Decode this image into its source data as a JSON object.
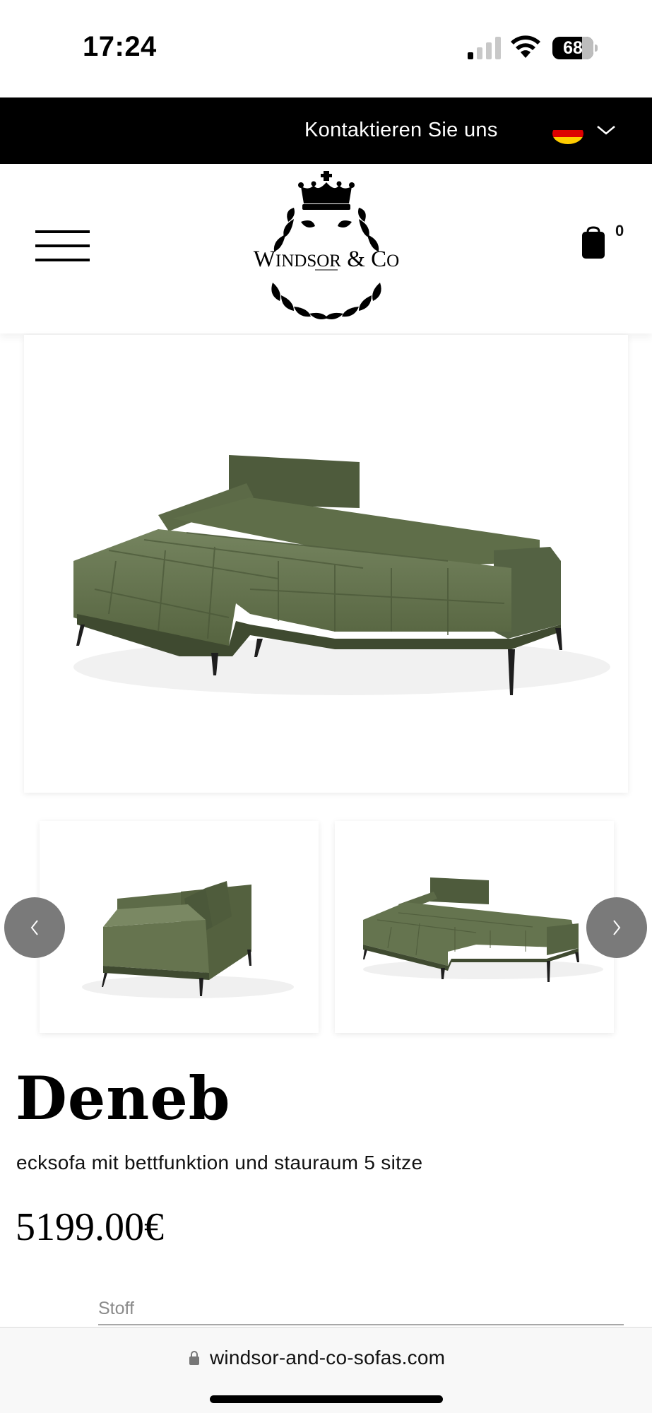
{
  "status_bar": {
    "time": "17:24",
    "battery_level": "68"
  },
  "topbar": {
    "contact_label": "Kontaktieren Sie uns",
    "language_flag": "germany-flag-icon"
  },
  "header": {
    "logo_text": "WINDSOR & CO",
    "cart_count": "0"
  },
  "gallery": {
    "main_image": "green-corner-sofa-image",
    "thumbnails": [
      "green-corner-sofa-side-view",
      "green-corner-sofa-bed-view"
    ]
  },
  "product": {
    "title": "Deneb",
    "subtitle": "ecksofa mit bettfunktion und stauraum 5 sitze",
    "price": "5199.00€",
    "fabric_label": "Stoff"
  },
  "browser": {
    "url": "windsor-and-co-sofas.com"
  },
  "colors": {
    "topbar": "#000000",
    "sofa_green": "#5f6f4e",
    "carousel_button": "#7a7a7a"
  }
}
